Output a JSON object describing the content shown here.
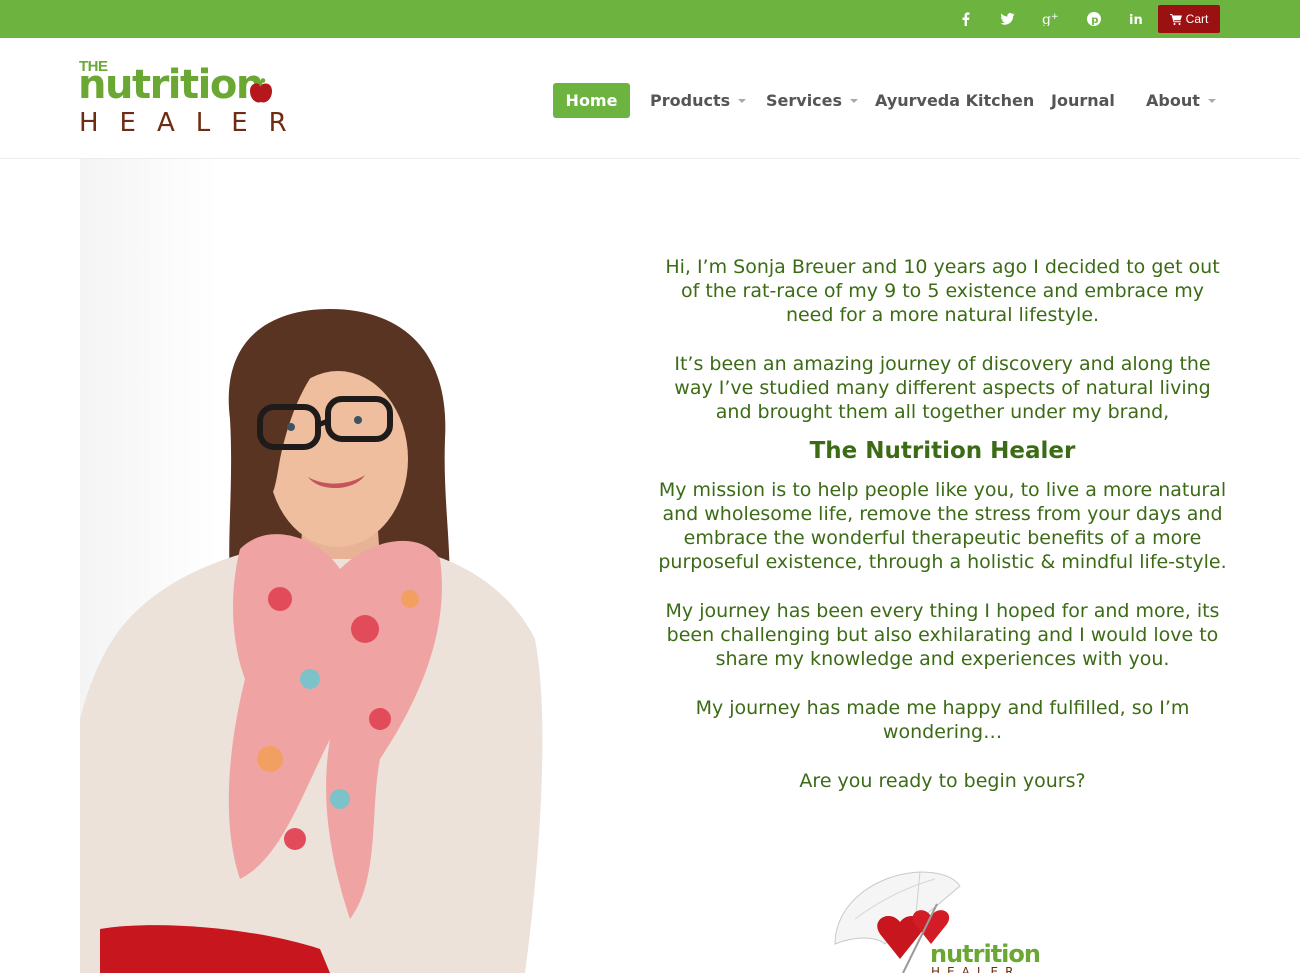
{
  "topbar": {
    "social": [
      {
        "icon": "facebook-icon",
        "glyph": "f"
      },
      {
        "icon": "twitter-icon",
        "glyph": ""
      },
      {
        "icon": "google-plus-icon",
        "glyph": "g+"
      },
      {
        "icon": "pinterest-icon",
        "glyph": "p"
      },
      {
        "icon": "linkedin-icon",
        "glyph": "in"
      }
    ],
    "cart_label": "Cart"
  },
  "logo": {
    "the": "THE",
    "word": "nutrition",
    "healer": "HEALER"
  },
  "nav": {
    "home": "Home",
    "products": "Products",
    "services": "Services",
    "ayurveda": "Ayurveda Kitchen",
    "journal": "Journal",
    "about": "About"
  },
  "intro": {
    "p1": "Hi, I’m Sonja Breuer and 10 years ago I decided to get out of the rat-race of my 9 to 5 existence and embrace my need for a more natural lifestyle.",
    "p2": "It’s been an amazing journey of discovery and along the way I’ve studied many different aspects of natural living and brought them all together under my brand,",
    "brand": "The Nutrition Healer",
    "p3": "My mission is to help people like you, to live a more natural and wholesome life, remove the stress from your days and embrace the wonderful therapeutic benefits of a more purposeful existence, through a holistic & mindful life-style.",
    "p4": "My journey has been every thing I hoped for and more, its been challenging but also exhilarating and I would love to share my knowledge and experiences with you.",
    "p5": "My journey has made me happy and fulfilled, so I’m wondering…",
    "p6": "Are you ready to begin yours?"
  },
  "badge": {
    "word": "nutrition",
    "healer": "HEALER"
  },
  "colors": {
    "brand_green": "#6db33f",
    "text_green": "#3c6b16",
    "cart_red": "#9b1111",
    "logo_brown": "#6e2c12"
  }
}
